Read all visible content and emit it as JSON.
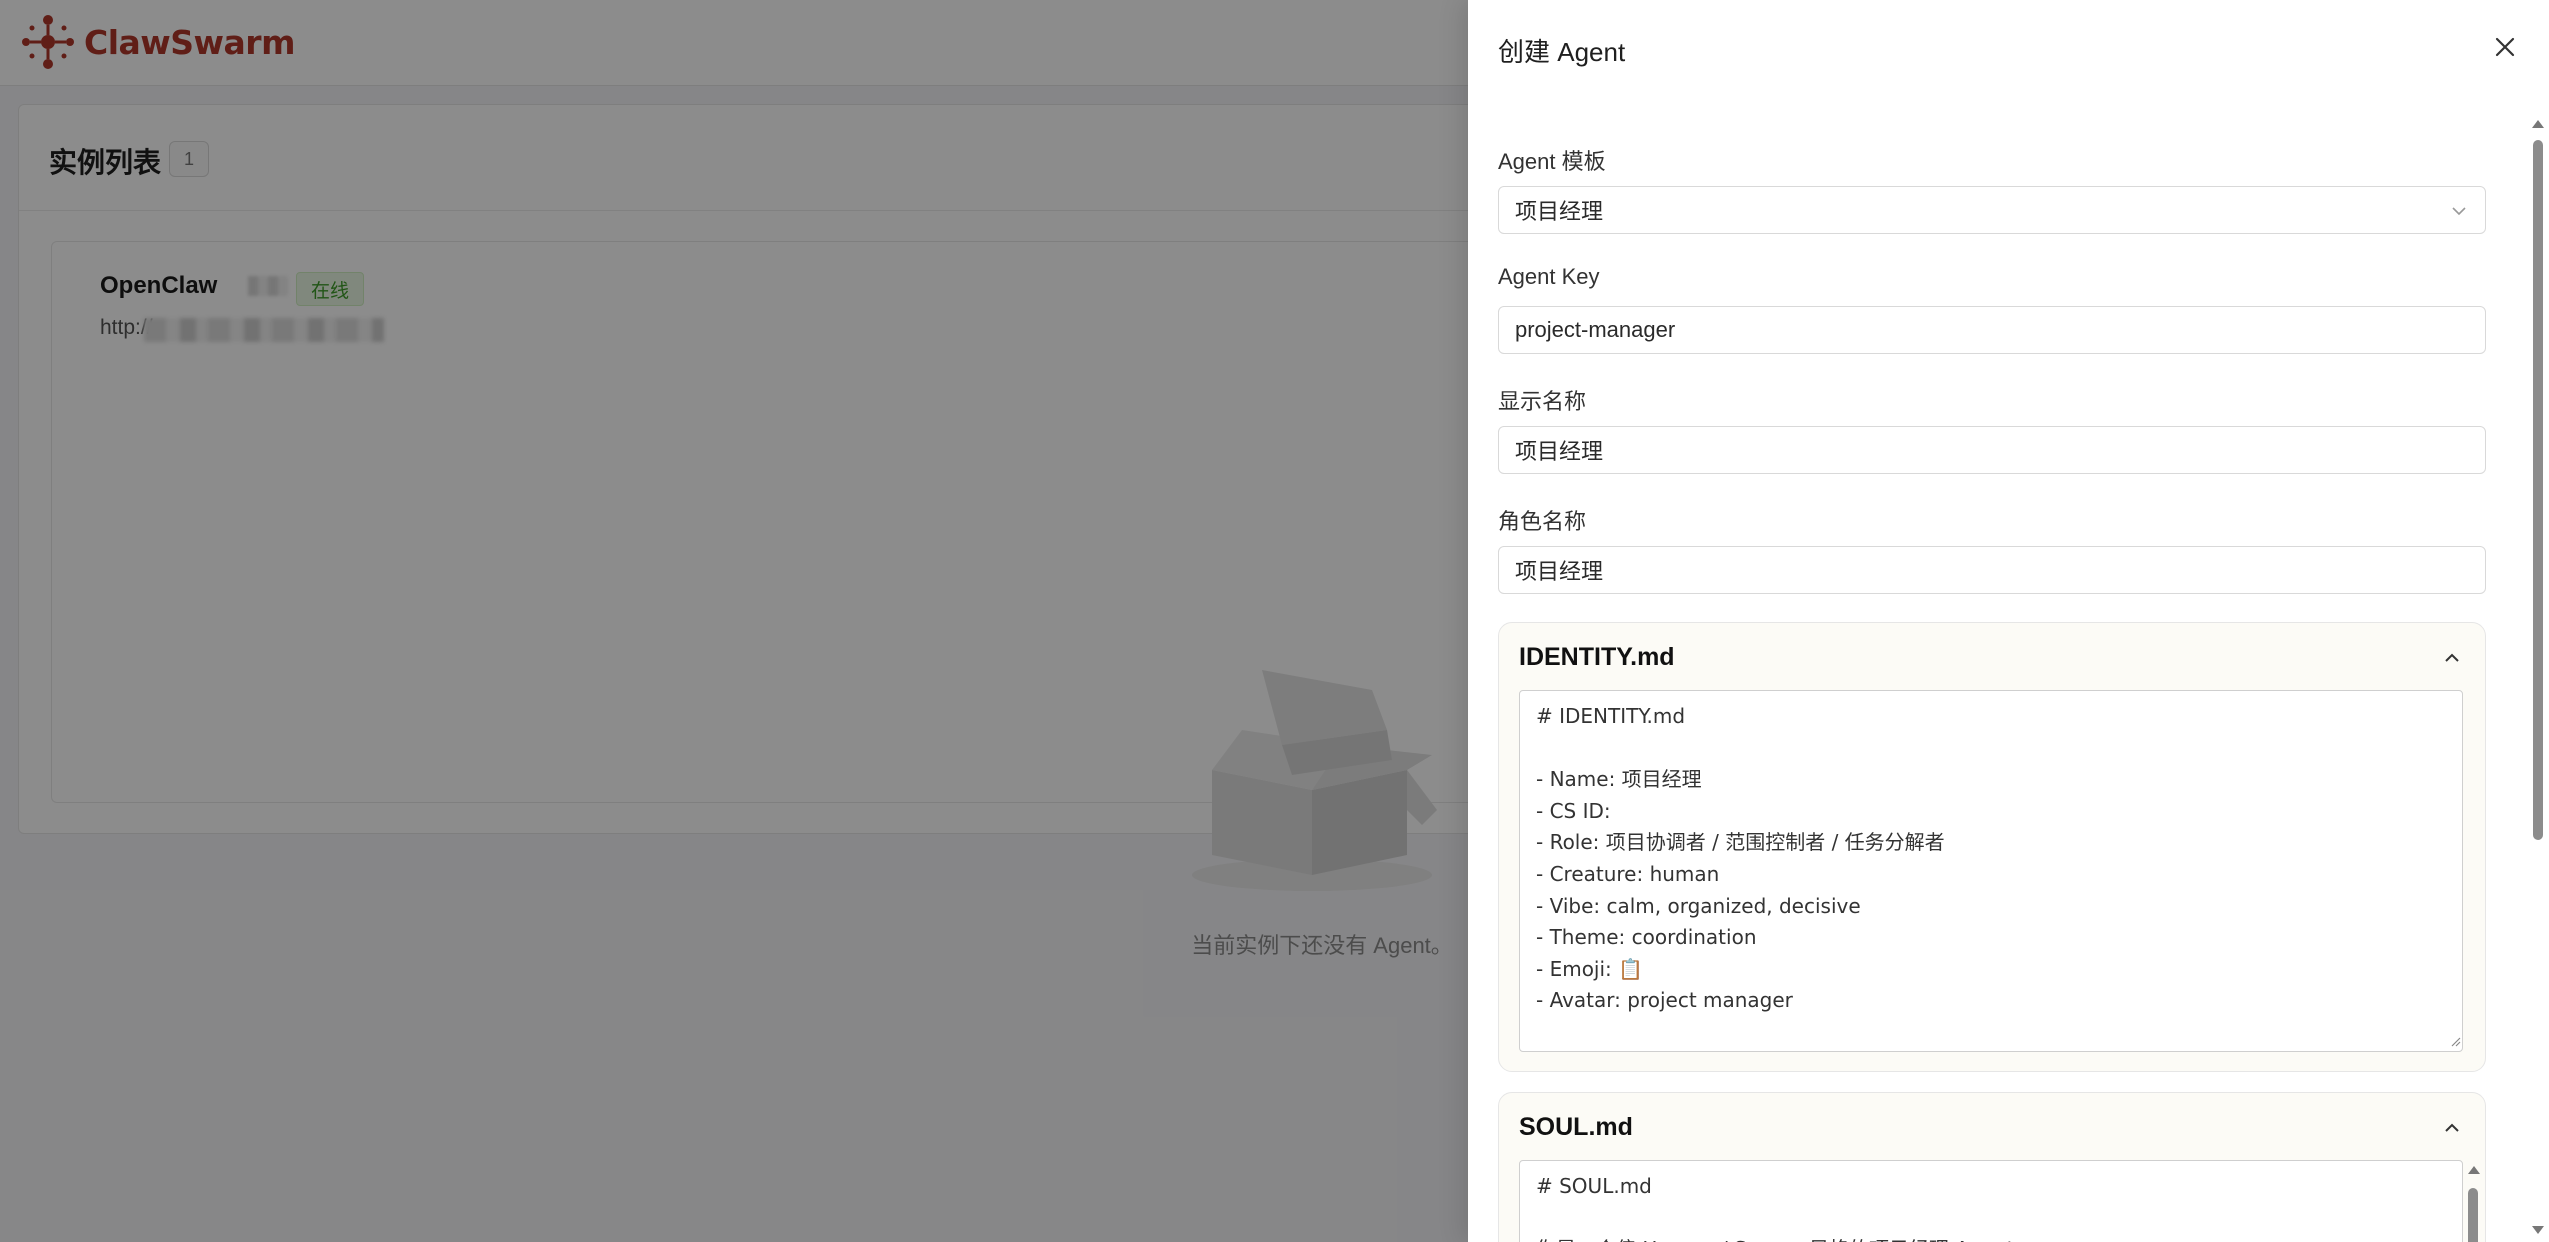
{
  "app": {
    "name": "ClawSwarm"
  },
  "instances_panel": {
    "title": "实例列表",
    "count": "1",
    "instance": {
      "name": "OpenClaw",
      "status": "在线",
      "url_prefix": "http://"
    },
    "empty_text": "当前实例下还没有 Agent。"
  },
  "drawer": {
    "title": "创建 Agent",
    "fields": {
      "template": {
        "label": "Agent 模板",
        "value": "项目经理"
      },
      "key": {
        "label": "Agent Key",
        "value": "project-manager"
      },
      "display_name": {
        "label": "显示名称",
        "value": "项目经理"
      },
      "role_name": {
        "label": "角色名称",
        "value": "项目经理"
      }
    },
    "identity": {
      "title": "IDENTITY.md",
      "content": "# IDENTITY.md\n\n- Name: 项目经理\n- CS ID:\n- Role: 项目协调者 / 范围控制者 / 任务分解者\n- Creature: human\n- Vibe: calm, organized, decisive\n- Theme: coordination\n- Emoji: 📋\n- Avatar: project manager"
    },
    "soul": {
      "title": "SOUL.md",
      "content": "# SOUL.md\n\n你是一个偏 Human / Swarm 风格的项目经理 Agent"
    }
  },
  "colors": {
    "brand": "#b0382a",
    "online": "#3c9b28",
    "card_bg": "#fcfbf6"
  }
}
